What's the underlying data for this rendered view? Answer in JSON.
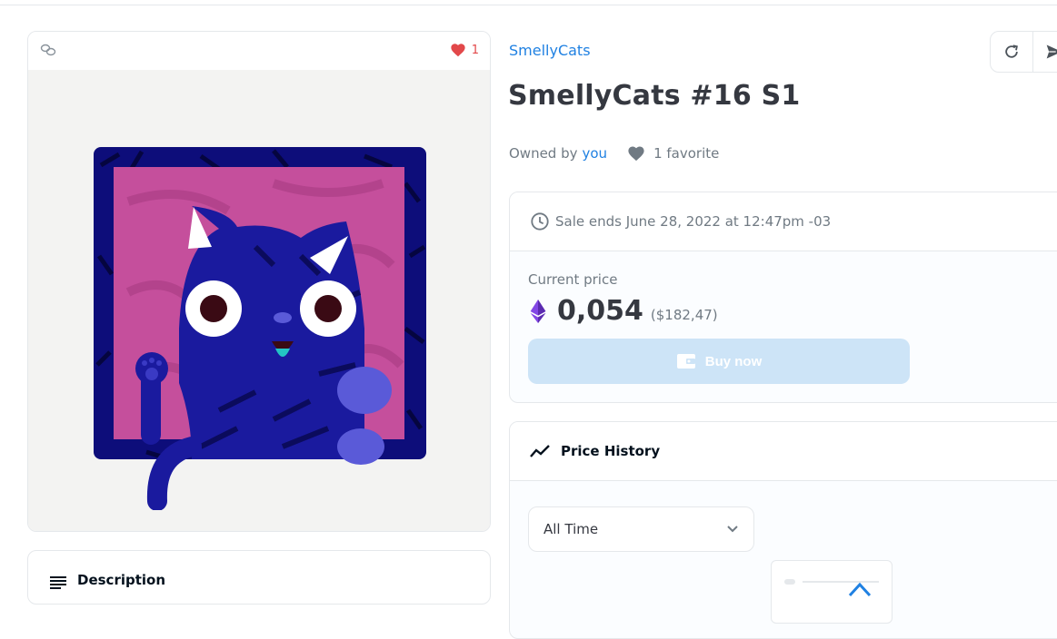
{
  "item": {
    "favorites_count": "1",
    "collection": "SmellyCats",
    "title": "SmellyCats #16 S1",
    "owned_by_label": "Owned by",
    "owner": "you",
    "favorites_label": "1 favorite"
  },
  "sale": {
    "ends_text": "Sale ends June 28, 2022 at 12:47pm -03",
    "current_price_label": "Current price",
    "price": "0,054",
    "price_usd": "($182,47)",
    "buy_label": "Buy now"
  },
  "price_history": {
    "title": "Price History",
    "range_selected": "All Time"
  },
  "description": {
    "title": "Description"
  },
  "icons": {
    "chain": "chain-link-icon",
    "heart": "heart-icon",
    "refresh": "refresh-icon",
    "share": "send-icon",
    "clock": "clock-icon",
    "eth": "ethereum-icon",
    "wallet": "wallet-icon",
    "trend": "trend-line-icon",
    "chevron": "chevron-down-icon",
    "list": "list-icon"
  },
  "colors": {
    "link": "#2081e2",
    "heart_red": "#e2484a",
    "buy_disabled": "#cde4f7",
    "art_frame": "#0d0d7a",
    "art_bg": "#c54f9c"
  }
}
